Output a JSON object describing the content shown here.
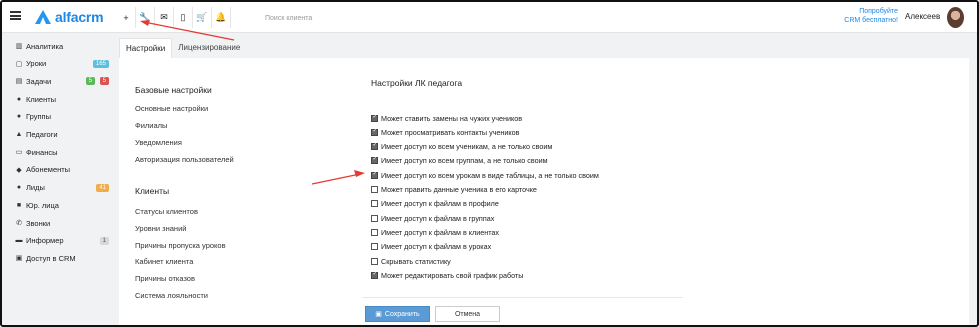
{
  "topbar": {
    "brand": "alfacrm",
    "toolbar_icons": [
      "plus-icon",
      "wrench-icon",
      "mail-icon",
      "phone-icon",
      "cart-icon",
      "bell-icon"
    ],
    "toolbar_glyphs": [
      "+",
      "🔧",
      "✉",
      "▯",
      "🛒",
      "🔔"
    ],
    "search_placeholder": "Поиск клиента",
    "promo_line1": "Попробуйте",
    "promo_line2": "CRM бесплатно!",
    "user_name": "Алексеев"
  },
  "sidebar": {
    "items": [
      {
        "label": "Аналитика",
        "icon": "chart-icon",
        "glyph": "▥"
      },
      {
        "label": "Уроки",
        "icon": "calendar-icon",
        "glyph": "▢",
        "badge": "165",
        "badge_color": "#5bc0de"
      },
      {
        "label": "Задачи",
        "icon": "tasks-icon",
        "glyph": "▤",
        "badge": "5",
        "badge_color": "#5cb85c",
        "badge2": "5",
        "badge2_color": "#d9534f"
      },
      {
        "label": "Клиенты",
        "icon": "user-icon",
        "glyph": "●"
      },
      {
        "label": "Группы",
        "icon": "group-icon",
        "glyph": "●"
      },
      {
        "label": "Педагоги",
        "icon": "graduation-cap-icon",
        "glyph": "▲"
      },
      {
        "label": "Финансы",
        "icon": "money-icon",
        "glyph": "▭"
      },
      {
        "label": "Абонементы",
        "icon": "tag-icon",
        "glyph": "◆"
      },
      {
        "label": "Лиды",
        "icon": "add-user-icon",
        "glyph": "●",
        "badge": "41",
        "badge_color": "#f0ad4e"
      },
      {
        "label": "Юр. лица",
        "icon": "briefcase-icon",
        "glyph": "■"
      },
      {
        "label": "Звонки",
        "icon": "phone-call-icon",
        "glyph": "✆"
      },
      {
        "label": "Информер",
        "icon": "informer-icon",
        "glyph": "▬",
        "badge": "1",
        "badge_color": "#d8d8d8"
      },
      {
        "label": "Доступ в CRM",
        "icon": "lock-icon",
        "glyph": "▣"
      }
    ]
  },
  "tabs": [
    {
      "label": "Настройки",
      "active": true
    },
    {
      "label": "Лицензирование",
      "active": false
    }
  ],
  "settings": {
    "basic_title": "Базовые настройки",
    "basic_links": [
      "Основные настройки",
      "Филиалы",
      "Уведомления",
      "Авторизация пользователей"
    ],
    "clients_title": "Клиенты",
    "clients_links": [
      "Статусы клиентов",
      "Уровни знаний",
      "Причины пропуска уроков",
      "Кабинет клиента",
      "Причины отказов",
      "Система лояльности"
    ]
  },
  "form": {
    "title": "Настройки ЛК педагога",
    "options": [
      {
        "label": "Может ставить замены на чужих учеников",
        "checked": true
      },
      {
        "label": "Может просматривать контакты учеников",
        "checked": true
      },
      {
        "label": "Имеет доступ ко всем ученикам, а не только своим",
        "checked": true
      },
      {
        "label": "Имеет доступ ко всем группам, а не только своим",
        "checked": true
      },
      {
        "label": "Имеет доступ ко всем урокам в виде таблицы, а не только своим",
        "checked": true
      },
      {
        "label": "Может править данные ученика в его карточке",
        "checked": false
      },
      {
        "label": "Имеет доступ к файлам в профиле",
        "checked": false
      },
      {
        "label": "Имеет доступ к файлам в группах",
        "checked": false
      },
      {
        "label": "Имеет доступ к файлам в клиентах",
        "checked": false
      },
      {
        "label": "Имеет доступ к файлам в уроках",
        "checked": false
      },
      {
        "label": "Скрывать статистику",
        "checked": false
      },
      {
        "label": "Может редактировать свой график работы",
        "checked": true
      }
    ],
    "save_label": "Сохранить",
    "cancel_label": "Отмена"
  },
  "annotation_color": "#e53935"
}
